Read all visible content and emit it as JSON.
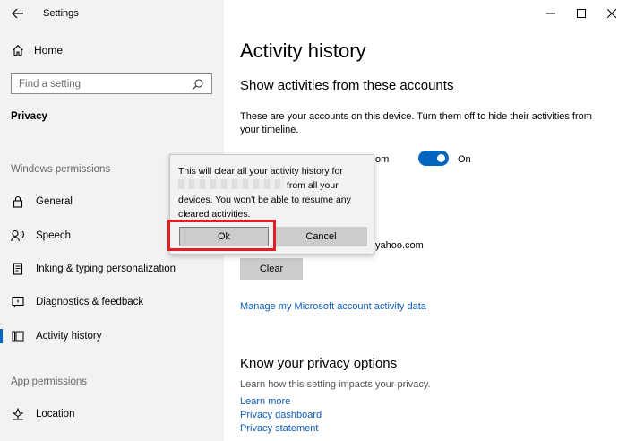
{
  "window": {
    "title": "Settings"
  },
  "sidebar": {
    "home_label": "Home",
    "search_placeholder": "Find a setting",
    "section": "Privacy",
    "groups": {
      "windows_permissions": "Windows permissions",
      "app_permissions": "App permissions"
    },
    "items": [
      {
        "label": "General",
        "icon": "lock-icon"
      },
      {
        "label": "Speech",
        "icon": "speech-icon"
      },
      {
        "label": "Inking & typing personalization",
        "icon": "inking-icon"
      },
      {
        "label": "Diagnostics & feedback",
        "icon": "diagnostics-icon"
      },
      {
        "label": "Activity history",
        "icon": "activity-history-icon",
        "active": true
      },
      {
        "label": "Location",
        "icon": "location-icon"
      }
    ]
  },
  "main": {
    "title": "Activity history",
    "accounts_heading": "Show activities from these accounts",
    "accounts_desc": "These are your accounts on this device. Turn them off to hide their activities from your timeline.",
    "account_fragment_1": "om",
    "toggle_label": "On",
    "account_fragment_2": "yahoo.com",
    "clear_label": "Clear",
    "manage_link": "Manage my Microsoft account activity data",
    "privacy_heading": "Know your privacy options",
    "privacy_desc": "Learn how this setting impacts your privacy.",
    "links": [
      "Learn more",
      "Privacy dashboard",
      "Privacy statement"
    ]
  },
  "dialog": {
    "line1": "This will clear all your activity history for",
    "line2_suffix": "from all your",
    "line3": "devices. You won't be able to resume any cleared activities.",
    "ok_label": "Ok",
    "cancel_label": "Cancel"
  },
  "colors": {
    "accent": "#0067c0",
    "link": "#0a5dbd",
    "highlight": "#e21d25",
    "sidebar_bg": "#f2f2f2"
  }
}
